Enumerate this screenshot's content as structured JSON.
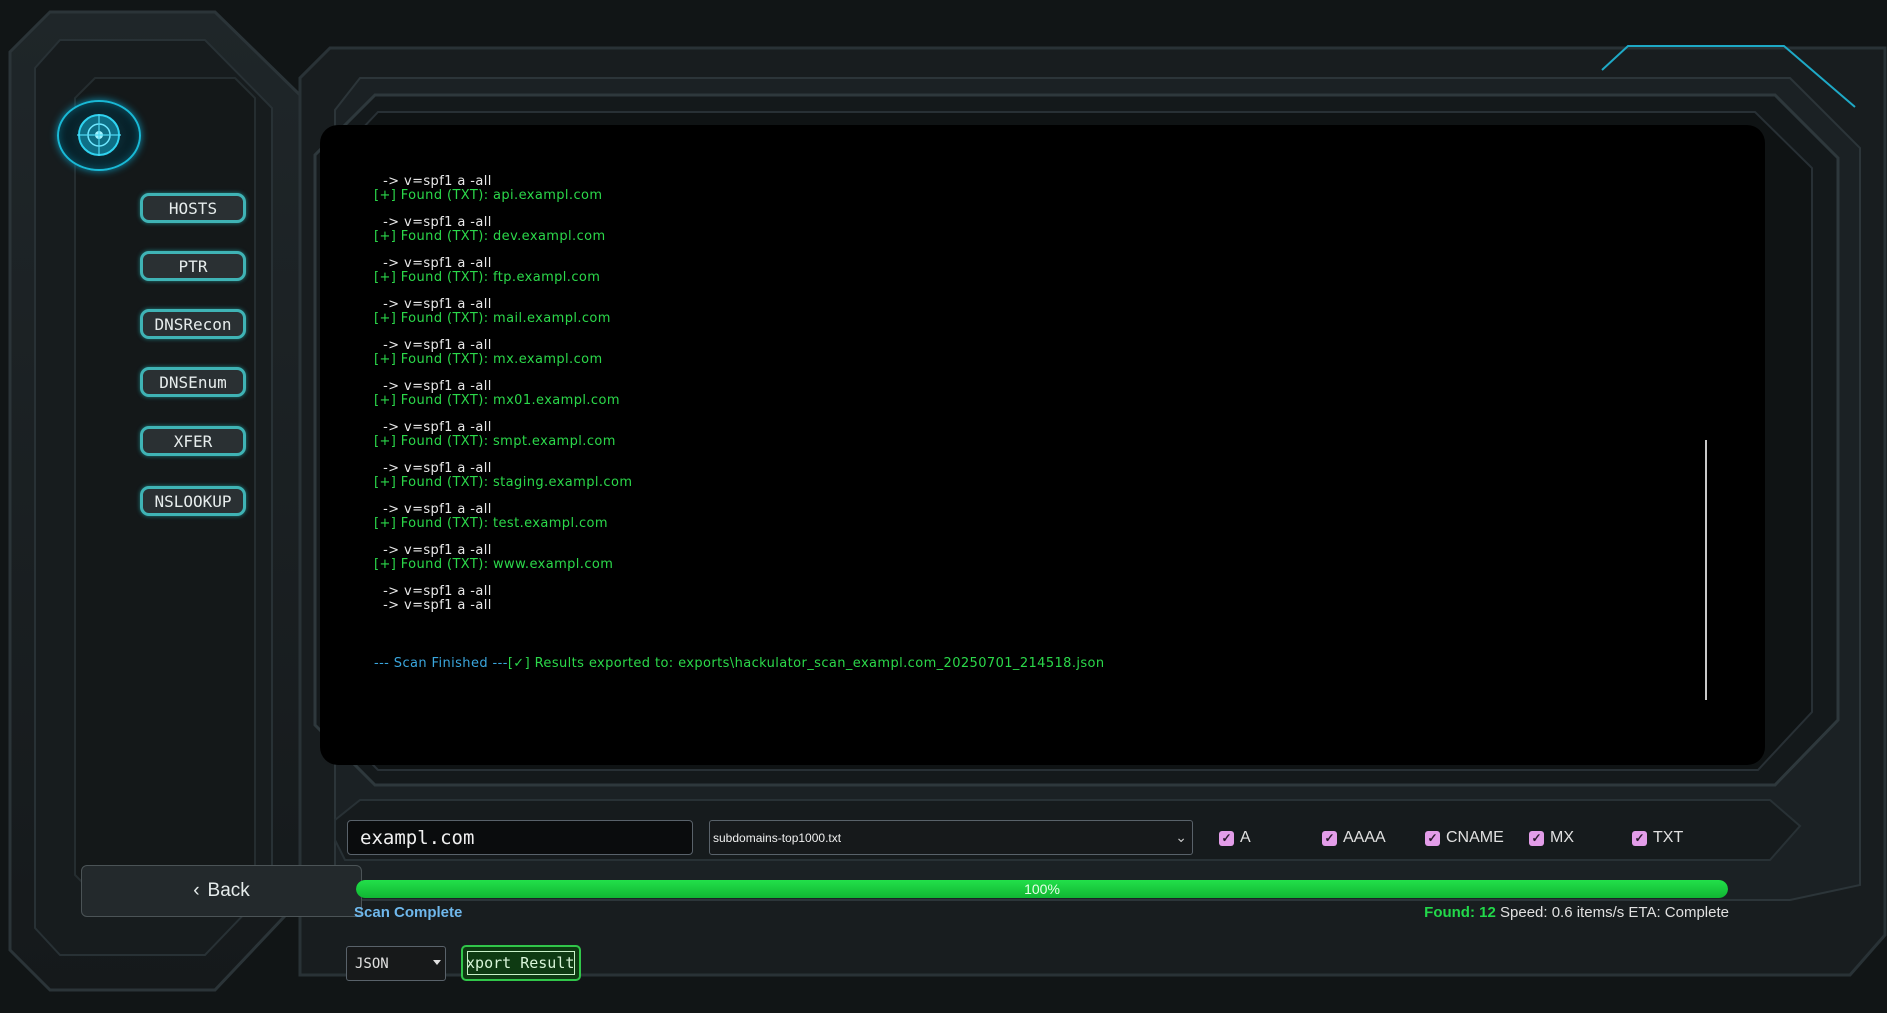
{
  "sidebar": {
    "items": [
      {
        "label": "HOSTS"
      },
      {
        "label": "PTR"
      },
      {
        "label": "DNSRecon"
      },
      {
        "label": "DNSEnum"
      },
      {
        "label": "XFER"
      },
      {
        "label": "NSLOOKUP"
      }
    ],
    "back_label": "Back"
  },
  "console": {
    "records": [
      {
        "spf": "  -> v=spf1 a -all",
        "found": "[+] Found (TXT): api.exampl.com"
      },
      {
        "spf": "  -> v=spf1 a -all",
        "found": "[+] Found (TXT): dev.exampl.com"
      },
      {
        "spf": "  -> v=spf1 a -all",
        "found": "[+] Found (TXT): ftp.exampl.com"
      },
      {
        "spf": "  -> v=spf1 a -all",
        "found": "[+] Found (TXT): mail.exampl.com"
      },
      {
        "spf": "  -> v=spf1 a -all",
        "found": "[+] Found (TXT): mx.exampl.com"
      },
      {
        "spf": "  -> v=spf1 a -all",
        "found": "[+] Found (TXT): mx01.exampl.com"
      },
      {
        "spf": "  -> v=spf1 a -all",
        "found": "[+] Found (TXT): smpt.exampl.com"
      },
      {
        "spf": "  -> v=spf1 a -all",
        "found": "[+] Found (TXT): staging.exampl.com"
      },
      {
        "spf": "  -> v=spf1 a -all",
        "found": "[+] Found (TXT): test.exampl.com"
      },
      {
        "spf": "  -> v=spf1 a -all",
        "found": "[+] Found (TXT): www.exampl.com"
      }
    ],
    "trailing": [
      "  -> v=spf1 a -all",
      "  -> v=spf1 a -all"
    ],
    "finished_label": "--- Scan Finished ---",
    "export_message": "[✓] Results exported to: exports\\hackulator_scan_exampl.com_20250701_214518.json"
  },
  "controls": {
    "domain_value": "exampl.com",
    "wordlist_value": "subdomains-top1000.txt",
    "record_types": [
      {
        "label": "A",
        "checked": true
      },
      {
        "label": "AAAA",
        "checked": true
      },
      {
        "label": "CNAME",
        "checked": true
      },
      {
        "label": "MX",
        "checked": true
      },
      {
        "label": "TXT",
        "checked": true
      }
    ]
  },
  "progress": {
    "value": 1.0,
    "label": "100%",
    "status": "Scan Complete",
    "found_label": "Found: 12",
    "speed_eta": "Speed: 0.6 items/s ETA: Complete"
  },
  "export": {
    "format": "JSON",
    "button_label": "Export Results"
  },
  "colors": {
    "accent_cyan": "#3fb3b5",
    "console_green": "#2bd84a",
    "console_blue": "#3aa6dd",
    "progress_green": "#22e04a",
    "checkbox_pink": "#e39de9"
  }
}
